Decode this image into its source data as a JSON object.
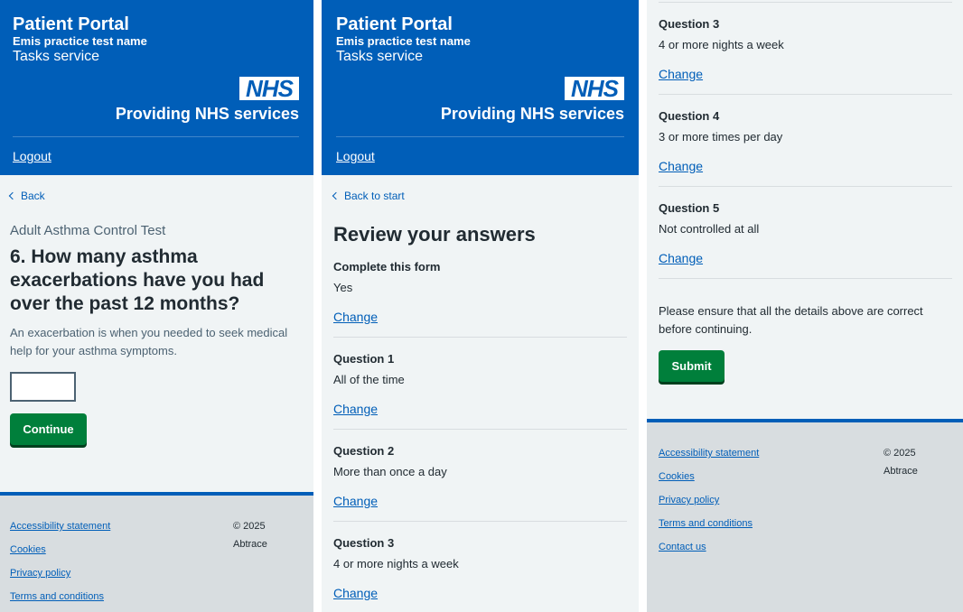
{
  "header": {
    "title": "Patient Portal",
    "practice": "Emis practice test name",
    "service": "Tasks service",
    "logo_text": "NHS",
    "providing": "Providing NHS services",
    "logout": "Logout"
  },
  "question_page": {
    "back": "Back",
    "caption": "Adult Asthma Control Test",
    "question": "6. How many asthma exacerbations have you had over the past 12 months?",
    "hint": "An exacerbation is when you needed to seek medical help for your asthma symptoms.",
    "input_value": "",
    "continue": "Continue"
  },
  "review_page": {
    "back": "Back to start",
    "heading": "Review your answers",
    "change_label": "Change",
    "rows": [
      {
        "label": "Complete this form",
        "answer": "Yes"
      },
      {
        "label": "Question 1",
        "answer": "All of the time"
      },
      {
        "label": "Question 2",
        "answer": "More than once a day"
      },
      {
        "label": "Question 3",
        "answer": "4 or more nights a week"
      },
      {
        "label": "Question 4",
        "answer": "3 or more times per day"
      },
      {
        "label": "Question 5",
        "answer": "Not controlled at all"
      }
    ],
    "confirm_text": "Please ensure that all the details above are correct before continuing.",
    "submit": "Submit"
  },
  "footer": {
    "links": [
      "Accessibility statement",
      "Cookies",
      "Privacy policy",
      "Terms and conditions",
      "Contact us"
    ],
    "copyright": "© 2025",
    "company": "Abtrace"
  },
  "colors": {
    "nhs_blue": "#005eb8",
    "button_green": "#007f3b",
    "page_bg": "#f0f4f5",
    "footer_bg": "#d8dde0"
  }
}
